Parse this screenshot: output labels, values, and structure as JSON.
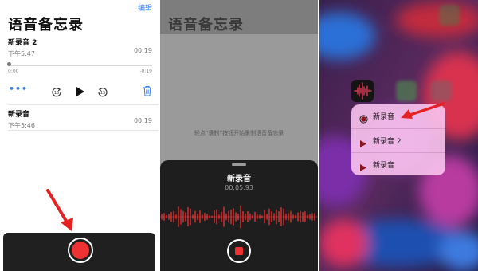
{
  "panel1": {
    "edit_label": "编辑",
    "title": "语音备忘录",
    "recordings": [
      {
        "name": "新录音 2",
        "time": "下午5:47",
        "duration": "00:19"
      },
      {
        "name": "新录音",
        "time": "下午5:46",
        "duration": "00:19"
      }
    ],
    "scrubber": {
      "elapsed": "0:00",
      "remaining": "-0:19",
      "progress": 0.0
    },
    "skip_seconds": "15"
  },
  "panel2": {
    "title": "语音备忘录",
    "hint": "轻点“录制”按钮开始录制语音备忘录",
    "sheet_title": "新录音",
    "sheet_time": "00:05.93"
  },
  "panel3": {
    "menu": [
      {
        "label": "新录音",
        "icon": "record-circle-icon"
      },
      {
        "label": "新录音 2",
        "icon": "play-triangle-icon"
      },
      {
        "label": "新录音",
        "icon": "play-triangle-icon"
      }
    ]
  },
  "colors": {
    "accent_blue": "#2f7ff5",
    "record_red": "#ee3232",
    "arrow_red": "#e52222",
    "menu_icon_red": "#8b1620",
    "menu_bg": "#fac4ee"
  }
}
